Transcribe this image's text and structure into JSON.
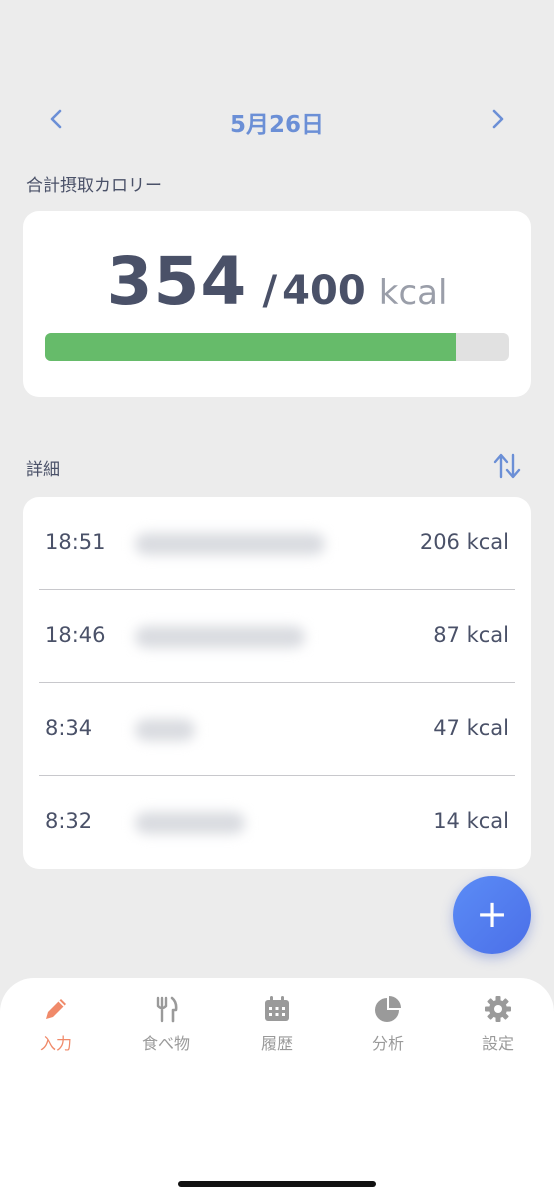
{
  "header": {
    "date": "5月26日",
    "prev_icon": "chevron-left-icon",
    "next_icon": "chevron-right-icon"
  },
  "total": {
    "section_label": "合計摂取カロリー",
    "consumed": "354",
    "separator": "/",
    "goal": "400",
    "unit": "kcal",
    "progress_fraction": 0.885,
    "progress_color": "#66bb6a"
  },
  "details": {
    "section_label": "詳細",
    "sort_icon": "sort-arrows-icon",
    "entries": [
      {
        "time": "18:51",
        "kcal": "206 kcal"
      },
      {
        "time": "18:46",
        "kcal": "87 kcal"
      },
      {
        "time": "8:34",
        "kcal": "47 kcal"
      },
      {
        "time": "8:32",
        "kcal": "14 kcal"
      }
    ]
  },
  "fab": {
    "label": "+",
    "icon": "plus-icon"
  },
  "tabs": [
    {
      "label": "入力",
      "icon": "pencil-icon",
      "active": true
    },
    {
      "label": "食べ物",
      "icon": "fork-knife-icon",
      "active": false
    },
    {
      "label": "履歴",
      "icon": "calendar-icon",
      "active": false
    },
    {
      "label": "分析",
      "icon": "pie-chart-icon",
      "active": false
    },
    {
      "label": "設定",
      "icon": "gear-icon",
      "active": false
    }
  ],
  "colors": {
    "accent": "#6b8fd6",
    "active_tab": "#f08a6a",
    "fab": "#4b6fe8",
    "background": "#ececec"
  }
}
